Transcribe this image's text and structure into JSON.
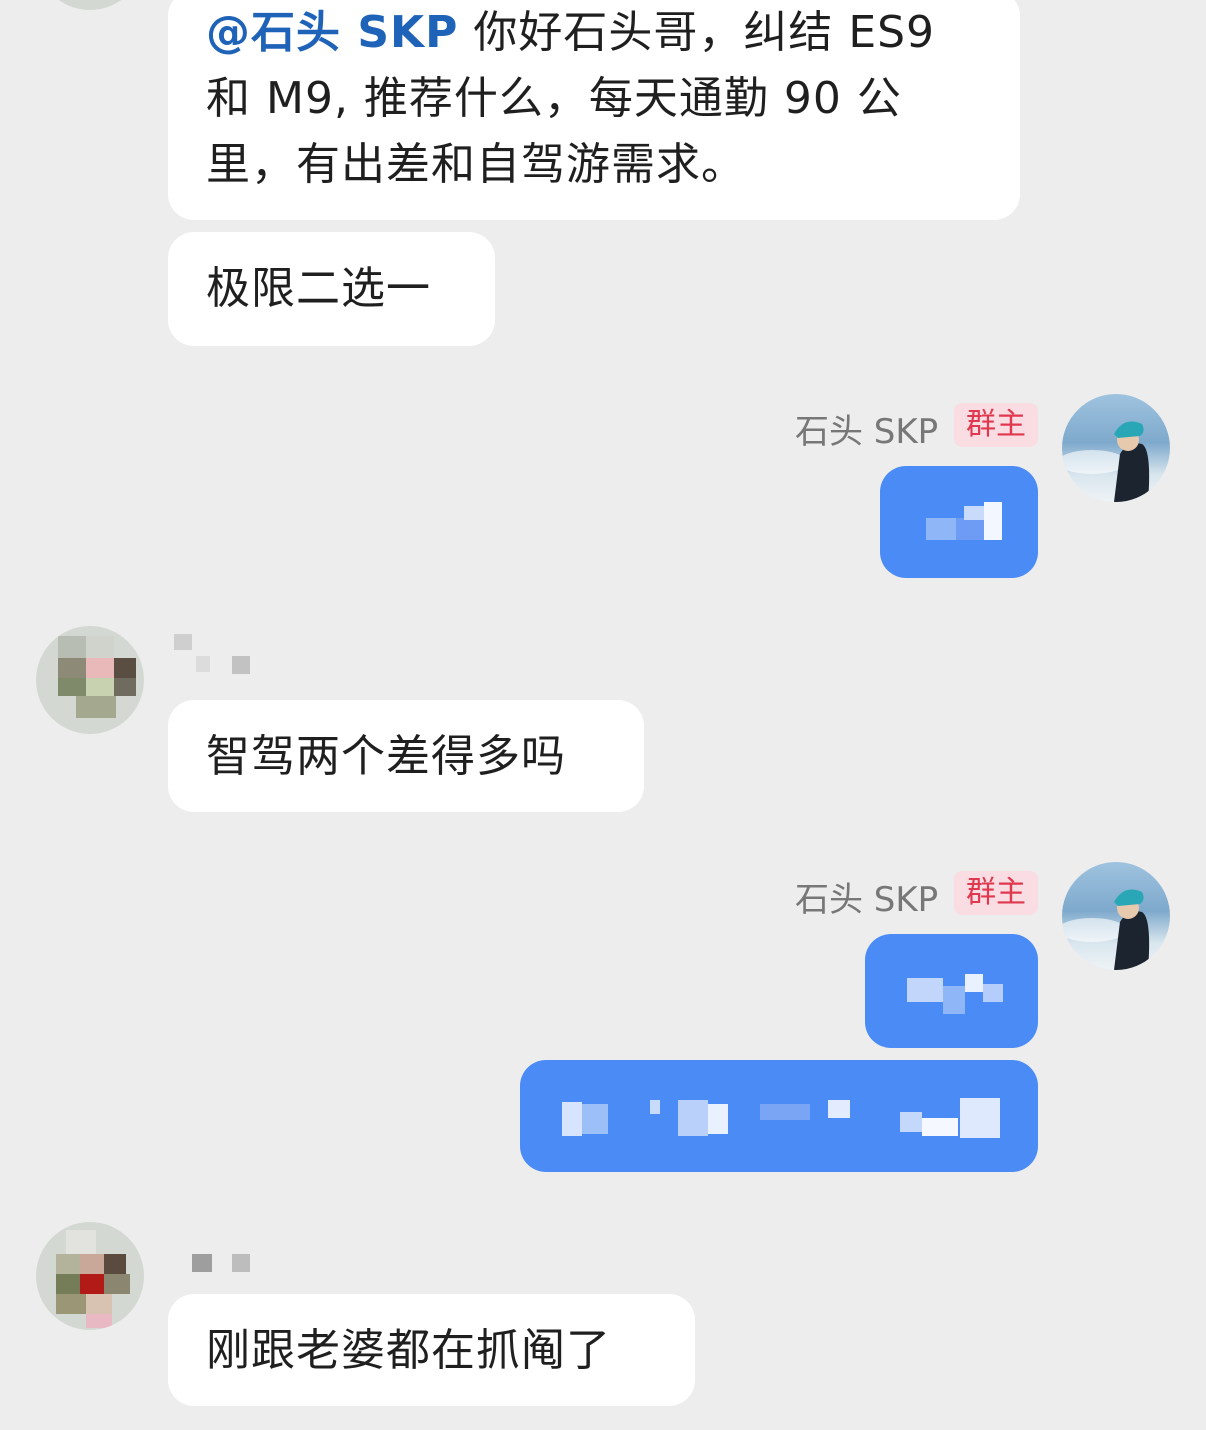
{
  "colors": {
    "background": "#ededed",
    "incoming_bubble": "#ffffff",
    "outgoing_bubble": "#4a8bf6",
    "mention": "#1f63b8",
    "owner_badge_bg": "#f9dde2",
    "owner_badge_text": "#e0384f"
  },
  "messages": [
    {
      "mention": "@石头 SKP",
      "text_line1": " 你好石头哥，纠结 ES9",
      "text_line2": "和 M9, 推荐什么，每天通勤 90 公",
      "text_line3": "里，有出差和自驾游需求。"
    },
    {
      "text": "极限二选一"
    },
    {
      "sender": "石头 SKP",
      "role": "群主"
    },
    {
      "text": "智驾两个差得多吗"
    },
    {
      "sender": "石头 SKP",
      "role": "群主"
    },
    {
      "text": "刚跟老婆都在抓阄了"
    }
  ],
  "icons": {
    "owner_avatar": "avatar-photo-person-icon",
    "member_avatar": "avatar-pixelated-icon"
  }
}
